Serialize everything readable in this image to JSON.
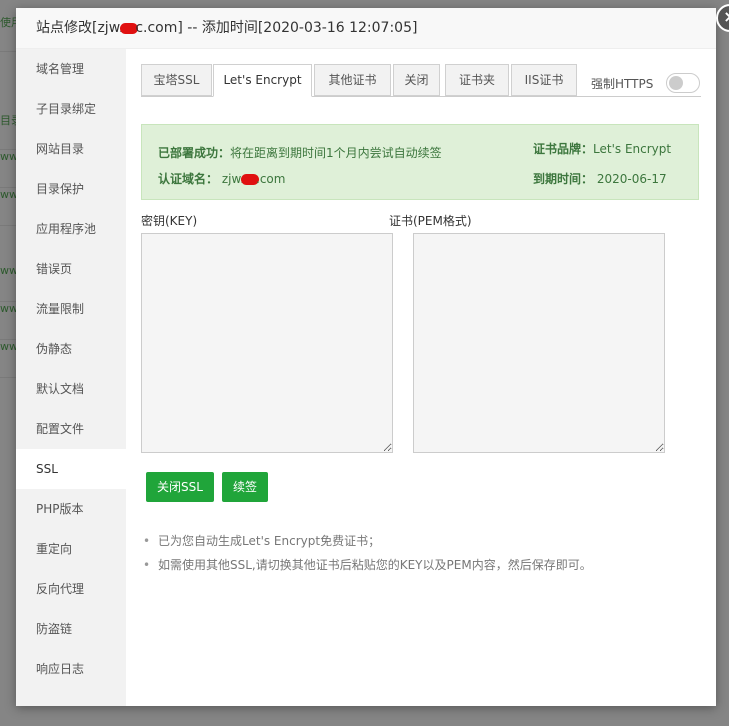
{
  "background": {
    "rows": [
      "使用",
      "",
      "目录",
      "ww",
      "ww",
      "ww",
      "ww",
      "ww",
      ""
    ]
  },
  "dialog": {
    "title_prefix": "站点修改[zjw.",
    "title_suffix": "c.com] -- 添加时间[2020-03-16 12:07:05]",
    "close_label": "×"
  },
  "sidebar": {
    "items": [
      {
        "label": "域名管理"
      },
      {
        "label": "子目录绑定"
      },
      {
        "label": "网站目录"
      },
      {
        "label": "目录保护"
      },
      {
        "label": "应用程序池"
      },
      {
        "label": "错误页"
      },
      {
        "label": "流量限制"
      },
      {
        "label": "伪静态"
      },
      {
        "label": "默认文档"
      },
      {
        "label": "配置文件"
      },
      {
        "label": "SSL"
      },
      {
        "label": "PHP版本"
      },
      {
        "label": "重定向"
      },
      {
        "label": "反向代理"
      },
      {
        "label": "防盗链"
      },
      {
        "label": "响应日志"
      }
    ],
    "active": "SSL"
  },
  "tabs": [
    {
      "label": "宝塔SSL"
    },
    {
      "label": "Let's Encrypt"
    },
    {
      "label": "其他证书"
    },
    {
      "label": "关闭"
    },
    {
      "label": "证书夹"
    },
    {
      "label": "IIS证书"
    }
  ],
  "active_tab": "Let's Encrypt",
  "https": {
    "label": "强制HTTPS",
    "enabled": false
  },
  "status": {
    "deployed_label": "已部署成功：",
    "deployed_text": "将在距离到期时间1个月内尝试自动续签",
    "domain_label": "认证域名：",
    "domain_prefix": "zjw.",
    "domain_suffix": ".com",
    "brand_label": "证书品牌：",
    "brand_value": "Let's Encrypt",
    "expiry_label": "到期时间：",
    "expiry_value": "2020-06-17"
  },
  "fields": {
    "key_label": "密钥(KEY)",
    "cert_label": "证书(PEM格式)",
    "key_value": "",
    "cert_value": ""
  },
  "buttons": {
    "close_ssl": "关闭SSL",
    "renew": "续签"
  },
  "notes": [
    "已为您自动生成Let's Encrypt免费证书；",
    "如需使用其他SSL,请切换其他证书后粘贴您的KEY以及PEM内容，然后保存即可。"
  ],
  "colors": {
    "accent_green": "#20a53a",
    "success_bg": "#dff0d8",
    "success_text": "#3c763d"
  }
}
